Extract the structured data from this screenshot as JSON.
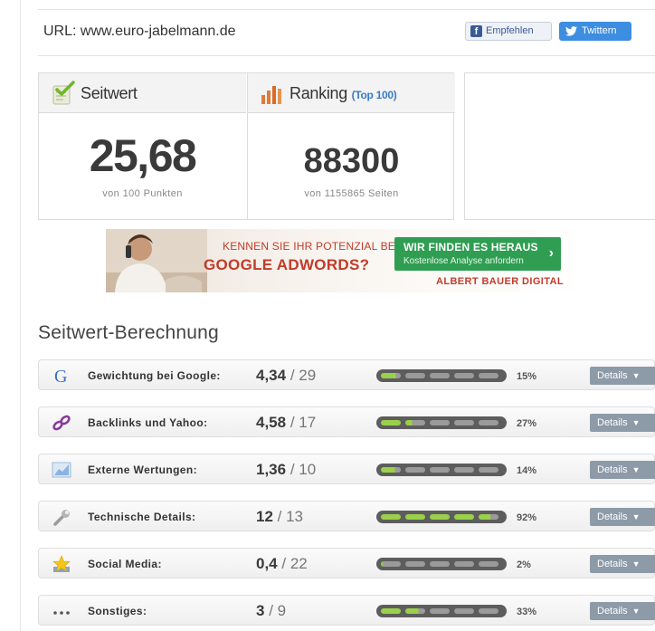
{
  "header": {
    "url_text": "URL: www.euro-jabelmann.de",
    "facebook_label": "Empfehlen",
    "twitter_label": "Twittern"
  },
  "scores": {
    "seitwert": {
      "title": "Seitwert",
      "value": "25,68",
      "caption": "von 100 Punkten"
    },
    "ranking": {
      "title": "Ranking",
      "badge": "(Top 100)",
      "value": "88300",
      "caption": "von 1155865 Seiten"
    }
  },
  "ad": {
    "line1": "KENNEN SIE IHR POTENZIAL BEI",
    "line2": "GOOGLE ADWORDS?",
    "cta_title": "WIR FINDEN ES HERAUS",
    "cta_sub": "Kostenlose Analyse anfordern",
    "cta_arrow": "›",
    "brand": "ALBERT BAUER DIGITAL"
  },
  "section_title": "Seitwert-Berechnung",
  "rows": [
    {
      "icon": "google-icon",
      "label": "Gewichtung bei Google:",
      "score": "4,34",
      "max": "29",
      "percent": "15%",
      "fill": 0.15,
      "details": "Details"
    },
    {
      "icon": "chain-link-icon",
      "label": "Backlinks und Yahoo:",
      "score": "4,58",
      "max": "17",
      "percent": "27%",
      "fill": 0.27,
      "details": "Details"
    },
    {
      "icon": "chart-icon",
      "label": "Externe Wertungen:",
      "score": "1,36",
      "max": "10",
      "percent": "14%",
      "fill": 0.14,
      "details": "Details"
    },
    {
      "icon": "wrench-icon",
      "label": "Technische Details:",
      "score": "12",
      "max": "13",
      "percent": "92%",
      "fill": 0.92,
      "details": "Details"
    },
    {
      "icon": "star-icon",
      "label": "Social Media:",
      "score": "0,4",
      "max": "22",
      "percent": "2%",
      "fill": 0.02,
      "details": "Details"
    },
    {
      "icon": "ellipsis-icon",
      "label": "Sonstiges:",
      "score": "3",
      "max": "9",
      "percent": "33%",
      "fill": 0.33,
      "details": "Details"
    }
  ],
  "colors": {
    "bar_fill": "#9bd04a",
    "bar_empty": "#9a9a9a",
    "ad_red": "#c23b2a",
    "cta_green": "#2f9e52",
    "link_blue": "#3a7bc8"
  }
}
